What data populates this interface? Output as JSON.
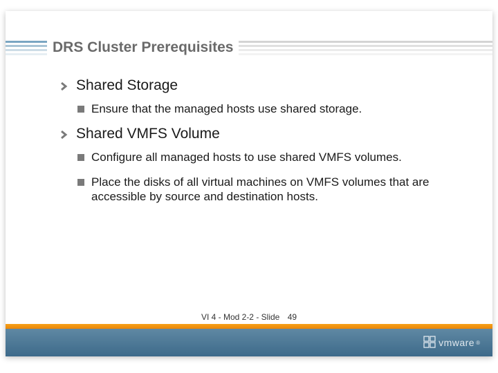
{
  "title": "DRS Cluster Prerequisites",
  "bullets": [
    {
      "text": "Shared Storage",
      "sub": [
        "Ensure that the managed hosts use shared storage."
      ]
    },
    {
      "text": "Shared VMFS Volume",
      "sub": [
        "Configure all managed hosts to use shared VMFS volumes.",
        "Place the disks of all virtual machines on VMFS volumes that are accessible by source and destination hosts."
      ]
    }
  ],
  "footer": {
    "label": "VI 4 - Mod 2-2 - Slide",
    "page": "49"
  },
  "brand": "vmware"
}
